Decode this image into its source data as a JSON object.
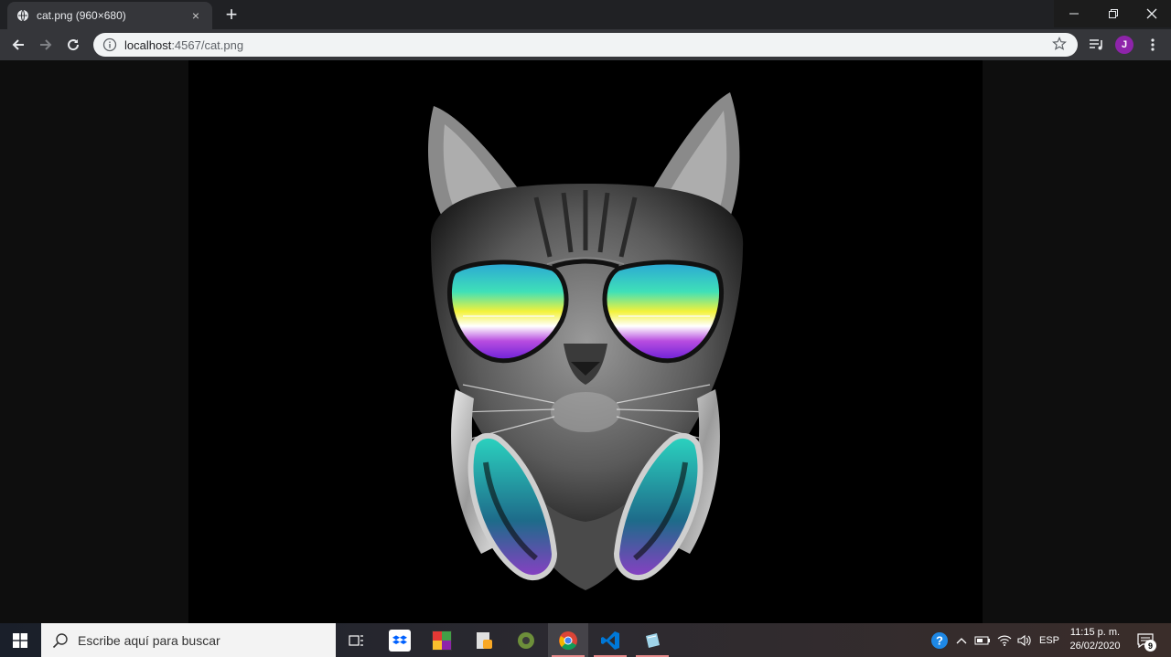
{
  "browser": {
    "tab": {
      "title": "cat.png (960×680)",
      "close_glyph": "×"
    },
    "new_tab_glyph": "+",
    "address": {
      "host": "localhost",
      "path": ":4567/cat.png"
    },
    "profile_initial": "J"
  },
  "taskbar": {
    "search_placeholder": "Escribe aquí para buscar",
    "language": "ESP",
    "time": "11:15 p. m.",
    "date": "26/02/2020",
    "notification_count": "9"
  },
  "colors": {
    "tabbar_bg": "#202124",
    "toolbar_bg": "#35363a",
    "omnibox_bg": "#f1f3f4",
    "avatar": "#8e24aa",
    "image_bg": "#000000"
  }
}
